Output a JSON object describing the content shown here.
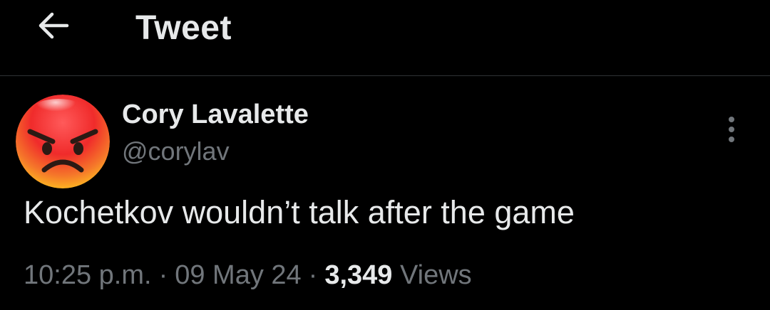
{
  "header": {
    "back_icon": "arrow-left-icon",
    "title": "Tweet"
  },
  "tweet": {
    "avatar_icon": "angry-face-emoji",
    "display_name": "Cory Lavalette",
    "handle": "@corylav",
    "more_icon": "vertical-ellipsis-icon",
    "text": "Kochetkov wouldn’t talk after the game",
    "time": "10:25 p.m.",
    "separator": "·",
    "date": "09 May 24",
    "views_count": "3,349",
    "views_label": "Views"
  },
  "colors": {
    "background": "#000000",
    "primary_text": "#e7e9ea",
    "secondary_text": "#71767b",
    "divider": "#2f3336"
  }
}
